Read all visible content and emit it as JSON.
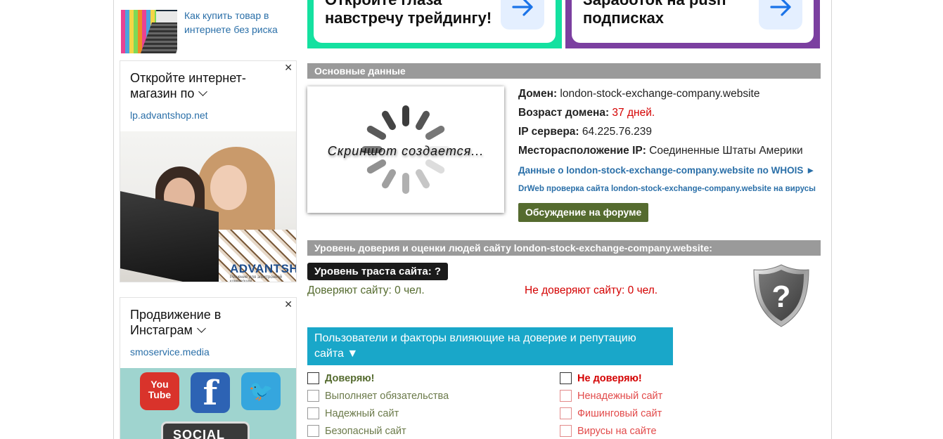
{
  "left": {
    "top_article": {
      "text": "Как купить товар в интернете без риска"
    },
    "ads": [
      {
        "close": "✕",
        "title": "Откройте интернет-магазин по",
        "link": "lp.advantshop.net",
        "brand": "ADVANTSHOP",
        "brand_sub": "Решение для электронной коммерции"
      },
      {
        "close": "✕",
        "title": "Продвижение в Инстаграм",
        "link": "smoservice.media",
        "social": {
          "youtube": "You Tube",
          "facebook": "f",
          "twitter": "🐦",
          "sign": "SOCIAL"
        }
      }
    ]
  },
  "promos": [
    {
      "line1": "Откройте глаза",
      "line2": "навстречу трейдингу!",
      "color": "#14e1a0"
    },
    {
      "line1": "Заработок на push",
      "line2": "подписках",
      "color": "#7b3fa0"
    }
  ],
  "main": {
    "section1_title": "Основные данные",
    "screenshot_text": "Скриншот создается...",
    "domain_label": "Домен:",
    "domain_value": "london-stock-exchange-company.website",
    "age_label": "Возраст домена:",
    "age_value": "37 дней.",
    "ip_label": "IP сервера:",
    "ip_value": "64.225.76.239",
    "location_label": "Месторасположение IP:",
    "location_value": "Соединенные Штаты Америки",
    "whois_link": "Данные о london-stock-exchange-company.website по WHOIS ►",
    "drweb_link": "DrWeb проверка сайта london-stock-exchange-company.website на вирусы",
    "forum_button": "Обсуждение на форуме",
    "section2_title": "Уровень доверия и оценки людей сайту london-stock-exchange-company.website:",
    "trust_level": "Уровень траста сайта: ?",
    "trust_yes": "Доверяют сайту: 0 чел.",
    "trust_no": "Не доверяют сайту: 0 чел.",
    "shield_glyph": "?",
    "factors_button": "Пользователи и факторы влияющие на доверие и репутацию сайта ▼",
    "trust_checks": [
      "Доверяю!",
      "Выполняет обязательства",
      "Надежный сайт",
      "Безопасный сайт"
    ],
    "distrust_checks": [
      "Не доверяю!",
      "Ненадежный сайт",
      "Фишинговый сайт",
      "Вирусы на сайте"
    ]
  },
  "colors": {
    "accent_blue": "#19a7c9",
    "section_gray": "#9a9a9a",
    "positive": "#556b2f",
    "negative": "#d40000"
  },
  "icons": {
    "promo_arrow": "arrow-right-icon",
    "shield": "shield-question-icon",
    "spinner": "loading-spinner-icon"
  }
}
